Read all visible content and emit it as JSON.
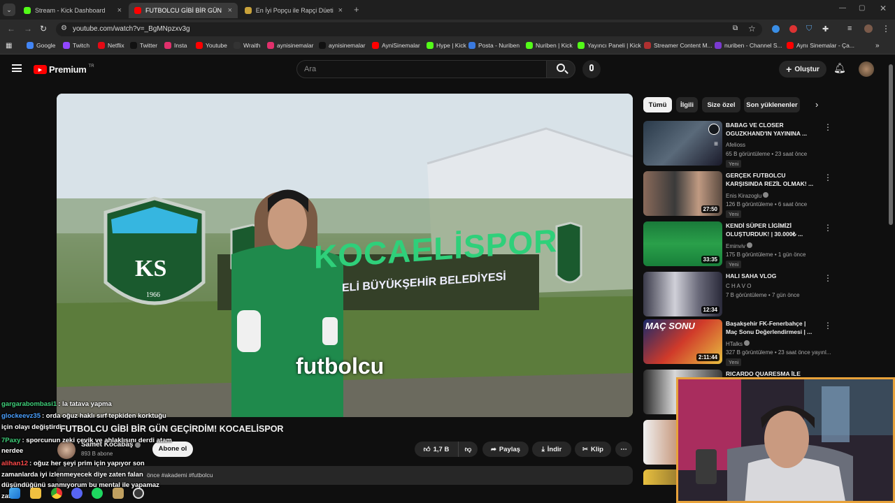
{
  "browser": {
    "tabs": [
      {
        "title": "Stream - Kick Dashboard"
      },
      {
        "title": "FUTBOLCU GİBİ BİR GÜN GEÇİR"
      },
      {
        "title": "En İyi Popçu ile Rapçi Düeti - Tc"
      }
    ],
    "url": "youtube.com/watch?v=_BgMNpzxv3g",
    "bookmarks": [
      "Google",
      "Twitch",
      "Netflix",
      "Twitter",
      "Insta",
      "Youtube",
      "Wraith",
      "aynisinemalar",
      "aynisinemalar",
      "AyniSinemalar",
      "Hype | Kick",
      "Posta - Nuriben",
      "Nuriben | Kick",
      "Yayıncı Paneli | Kick",
      "Streamer Content M...",
      "nuriben - Channel S...",
      "Aynı Sinemalar - Ça..."
    ]
  },
  "youtube": {
    "logo_text": "Premium",
    "logo_badge": "TR",
    "search_placeholder": "Ara",
    "create_label": "Oluştur",
    "chips": [
      "Tümü",
      "İlgili",
      "Size özel",
      "Son yüklenenler"
    ],
    "video": {
      "subtitle": "futbolcu",
      "sign_text": "KOCAELİSPOR",
      "sign_sub": "ELİ BÜYÜKŞEHİR BELEDİYESİ",
      "crest_year": "1966",
      "title": "FUTBOLCU GİBİ BİR GÜN GEÇİRDİM! KOCAELİSPOR",
      "channel": "Samet Kocabaş",
      "subs": "893 B abone",
      "subscribe": "Abone ol",
      "likes": "1,7 B",
      "share": "Paylaş",
      "download": "İndir",
      "clip": "Klip",
      "desc": "önce #akademi #futbolcu"
    },
    "recommendations": [
      {
        "title": "BABAG VE CLOSER OGUZKHAND'IN YAYININA ...",
        "channel": "Afelioss",
        "meta": "65 B görüntüleme • 23 saat önce",
        "badge": "Yeni",
        "duration": ""
      },
      {
        "title": "GERÇEK FUTBOLCU KARŞISINDA REZİL OLMAK! ...",
        "channel": "Enis Kirazoglu",
        "meta": "126 B görüntüleme • 6 saat önce",
        "badge": "Yeni",
        "duration": "27:50"
      },
      {
        "title": "KENDİ SÜPER LİGİMİZİ OLUŞTURDUK! | 30.000₺ ...",
        "channel": "Eminviv",
        "meta": "175 B görüntüleme • 1 gün önce",
        "badge": "Yeni",
        "duration": "33:35"
      },
      {
        "title": "HALI SAHA VLOG",
        "channel": "C H A V O",
        "meta": "7 B görüntüleme • 7 gün önce",
        "badge": "",
        "duration": "12:34"
      },
      {
        "title": "Başakşehir FK-Fenerbahçe | Maç Sonu Değerlendirmesi | ...",
        "channel": "HTalks",
        "meta": "327 B görüntüleme • 23 saat önce yayınl...",
        "badge": "Yeni",
        "duration": "2:11:44"
      },
      {
        "title": "RICARDO QUARESMA İLE",
        "channel": "",
        "meta": "",
        "badge": "",
        "duration": ""
      }
    ]
  },
  "chat": [
    {
      "user": "gargarabombasi1",
      "color": "#3fd07a",
      "text": ": la tatava yapma"
    },
    {
      "user": "glockeevz35",
      "color": "#4aa0ff",
      "text": ": orda oğuz haklı sırf tepkiden korktuğu"
    },
    {
      "user": "",
      "color": "#fff",
      "text": "için olayı değiştirdi"
    },
    {
      "user": "7Paxy",
      "color": "#3fd07a",
      "text": ": sporcunun zeki çevik ve ahlaklısını derdi atam"
    },
    {
      "user": "",
      "color": "#fff",
      "text": "nerdee"
    },
    {
      "user": "alihan12",
      "color": "#ff4a4a",
      "text": ": oğuz her şeyi prim için yapıyor son"
    },
    {
      "user": "",
      "color": "#fff",
      "text": "zamanlarda iyi izlenmeyecek diye zaten falan"
    },
    {
      "user": "",
      "color": "#fff",
      "text": "düşündüğünü sanmıyorum bu mental ile yapamaz"
    },
    {
      "user": "",
      "color": "#fff",
      "text": "zaten"
    }
  ],
  "colors": {
    "accent": "#ff0000",
    "cam_border": "#e8a23a"
  }
}
